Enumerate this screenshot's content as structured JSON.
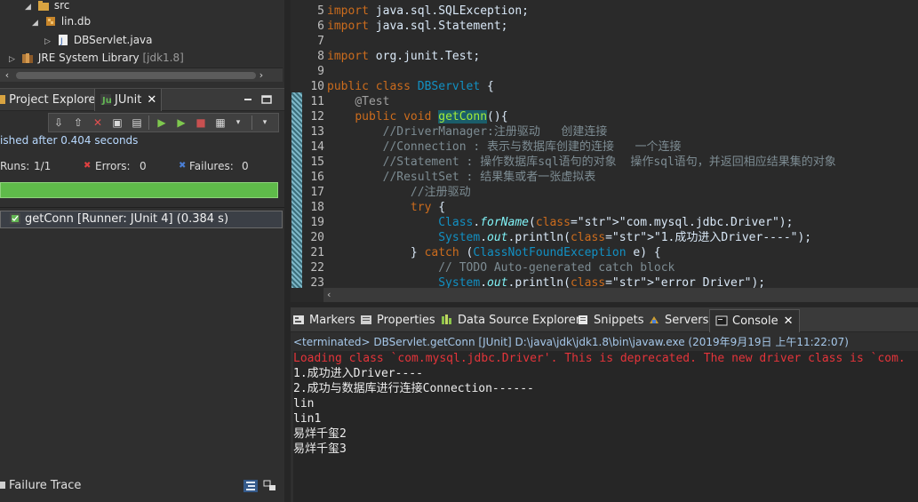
{
  "project_tree": {
    "items": [
      {
        "label": "src",
        "indent": 1
      },
      {
        "label": "lin.db",
        "indent": 2
      },
      {
        "label": "DBServlet.java",
        "indent": 3
      },
      {
        "label": "JRE System Library",
        "suffix": "[jdk1.8]",
        "indent": 1
      }
    ]
  },
  "left_tabs": {
    "project_explorer": "Project Explorer",
    "junit": "JUnit"
  },
  "junit": {
    "status": "ished after 0.404 seconds",
    "runs_label": "Runs:",
    "runs_value": "1/1",
    "errors_label": "Errors:",
    "errors_value": "0",
    "failures_label": "Failures:",
    "failures_value": "0",
    "progress_fraction": 1.0,
    "progress_color": "#5fbb4a",
    "result": "getConn [Runner: JUnit 4] (0.384 s)",
    "failure_trace_label": "Failure Trace"
  },
  "editor": {
    "lines": [
      {
        "n": "5",
        "t": "import java.sql.SQLException;"
      },
      {
        "n": "6",
        "t": "import java.sql.Statement;"
      },
      {
        "n": "7",
        "t": ""
      },
      {
        "n": "8",
        "t": "import org.junit.Test;"
      },
      {
        "n": "9",
        "t": ""
      },
      {
        "n": "10",
        "t": "public class DBServlet {"
      },
      {
        "n": "11",
        "t": "    @Test"
      },
      {
        "n": "12",
        "t": "    public void getConn(){"
      },
      {
        "n": "13",
        "t": "        //DriverManager:注册驱动   创建连接"
      },
      {
        "n": "14",
        "t": "        //Connection : 表示与数据库创建的连接   一个连接"
      },
      {
        "n": "15",
        "t": "        //Statement : 操作数据库sql语句的对象  操作sql语句，并返回相应结果集的对象"
      },
      {
        "n": "16",
        "t": "        //ResultSet : 结果集或者一张虚拟表"
      },
      {
        "n": "17",
        "t": "            //注册驱动"
      },
      {
        "n": "18",
        "t": "            try {"
      },
      {
        "n": "19",
        "t": "                Class.forName(\"com.mysql.jdbc.Driver\");"
      },
      {
        "n": "20",
        "t": "                System.out.println(\"1.成功进入Driver----\");"
      },
      {
        "n": "21",
        "t": "            } catch (ClassNotFoundException e) {"
      },
      {
        "n": "22",
        "t": "                // TODO Auto-generated catch block"
      },
      {
        "n": "23",
        "t": "                System.out.println(\"error Driver\");"
      }
    ]
  },
  "console_tabs": {
    "markers": "Markers",
    "properties": "Properties",
    "data_source_explorer": "Data Source Explorer",
    "snippets": "Snippets",
    "servers": "Servers",
    "console": "Console"
  },
  "console": {
    "status": "<terminated> DBServlet.getConn [JUnit] D:\\java\\jdk\\jdk1.8\\bin\\javaw.exe (2019年9月19日 上午11:22:07)",
    "lines": [
      {
        "t": "Loading class `com.mysql.jdbc.Driver'. This is deprecated. The new driver class is `com.",
        "c": "red"
      },
      {
        "t": "1.成功进入Driver----",
        "c": ""
      },
      {
        "t": "2.成功与数据库进行连接Connection------",
        "c": ""
      },
      {
        "t": "lin",
        "c": ""
      },
      {
        "t": "lin1",
        "c": ""
      },
      {
        "t": "易烊千玺2",
        "c": ""
      },
      {
        "t": "易烊千玺3",
        "c": ""
      }
    ]
  }
}
